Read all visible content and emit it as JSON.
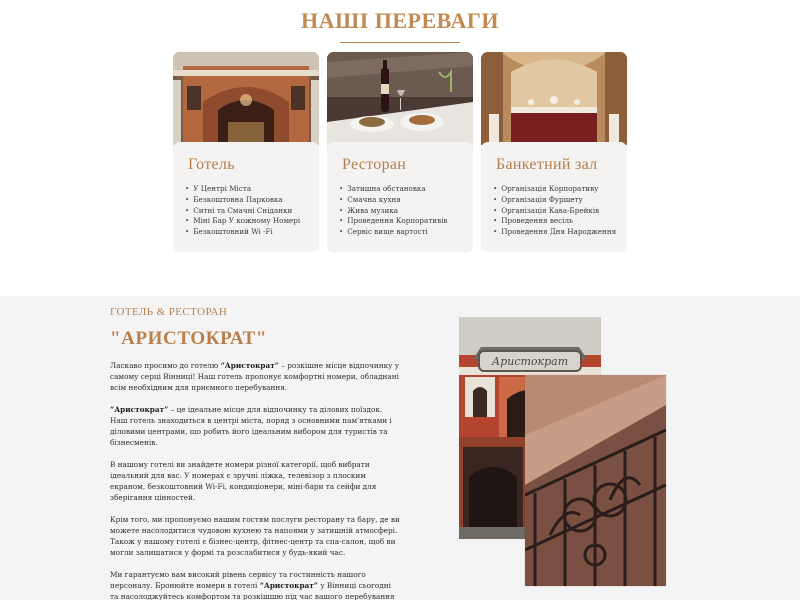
{
  "advantages": {
    "title": "НАШІ ПЕРЕВАГИ",
    "cards": [
      {
        "title": "Готель",
        "items": [
          "У Центрі Міста",
          "Безкоштовна Парковка",
          "Ситні та Смачні Сніданки",
          "Міні Бар У кожному Номері",
          "Безкоштовний Wi -Fi"
        ]
      },
      {
        "title": "Ресторан",
        "items": [
          "Затишна обстановка",
          "Смачна кухня",
          "Жива музика",
          "Проведення Корпоративів",
          "Сервіс вище вартості"
        ]
      },
      {
        "title": "Банкетний зал",
        "items": [
          "Організація Корпоративу",
          "Організація Фуршету",
          "Організація Кава-Брейків",
          "Проведення весіль",
          "Проведення Дня Народження"
        ]
      }
    ]
  },
  "about": {
    "subtitle": "ГОТЕЛЬ & РЕСТОРАН",
    "title": "\"АРИСТОКРАТ\"",
    "p1_b": "“Аристократ”",
    "p1_pre": "Ласкаво просимо до готелю ",
    "p1_rest": " – розкішне місце відпочинку у самому серці Вінниці! Наш готель пропонує комфортні номери, обладнані всім необхідним для приємного перебування.",
    "p2_b": "“Аристократ”",
    "p2_rest": " – це ідеальне місце для відпочинку та ділових поїздок. Наш готель знаходиться в центрі міста, поряд з основними пам'ятками і діловими центрами, що робить його ідеальним вибором для туристів та бізнесменів.",
    "p3": "В нашому готелі ви знайдете номери різної категорії, щоб вибрати ідеальний для вас. У номерах є зручні ліжка, телевізор з плоским екраном, безкоштовний Wi-Fi, кондиціонери, міні-бари та сейфи для зберігання цінностей.",
    "p4": "Крім того, ми пропонуємо нашим гостям послуги ресторану та бару, де ви можете насолодитися чудовою кухнею та напоями у затишній атмосфері. Також у нашому готелі є бізнес-центр, фітнес-центр та спа-салон, щоб ви могли залишатися у формі та розслабитися у будь-який час.",
    "p5_pre": "Ми гарантуємо вам високий рівень сервісу та гостинність нашого персоналу. Бронюйте номери в готелі ",
    "p5_b": "“Аристократ”",
    "p5_rest": " у Вінниці сьогодні та насолоджуйтесь комфортом та розкішшю під час вашого перебування у місті.",
    "sign_text": "Аристократ"
  },
  "colors": {
    "accent": "#c08a52",
    "card_bg": "#f4f3f2",
    "section_bg": "#f5f4f4"
  }
}
